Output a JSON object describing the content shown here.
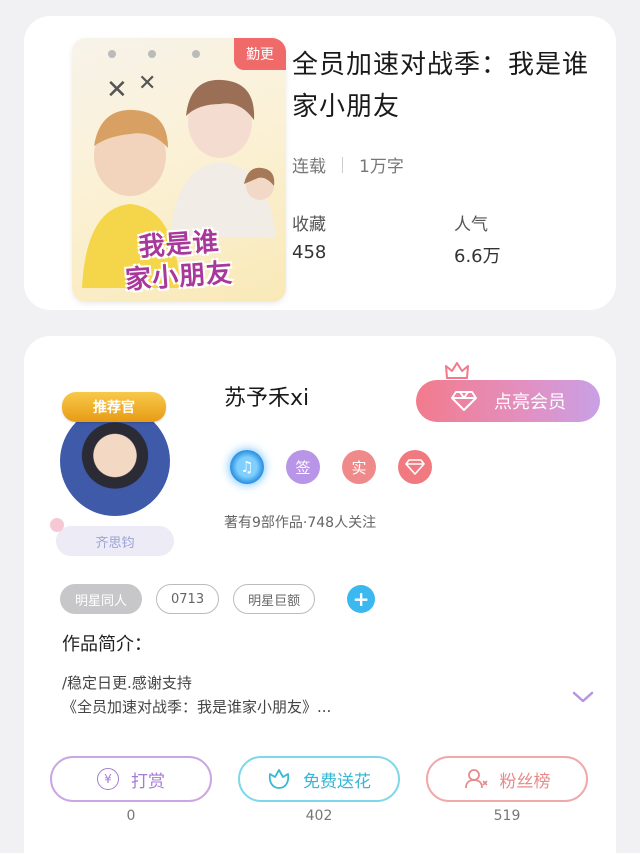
{
  "book": {
    "cover_tag": "勤更",
    "cover_title_1": "我是谁",
    "cover_title_2": "家小朋友",
    "title": "全员加速对战季：我是谁家小朋友",
    "status": "连载",
    "word_count": "1万字",
    "favorites_label": "收藏",
    "favorites_value": "458",
    "popularity_label": "人气",
    "popularity_value": "6.6万"
  },
  "author": {
    "badge_ribbon": "推荐官",
    "name_tag": "齐思钧",
    "name": "苏予禾xi",
    "vip_label": "点亮会员",
    "badges": [
      "♫",
      "签",
      "实",
      "diamond-icon"
    ],
    "works_line": "著有9部作品·748人关注",
    "tags": [
      "明星同人",
      "0713",
      "明星巨额"
    ],
    "intro_title": "作品简介：",
    "intro_line_1": "/稳定日更.感谢支持",
    "intro_line_2": "《全员加速对战季：我是谁家小朋友》..."
  },
  "actions": {
    "reward_label": "打赏",
    "reward_count": "0",
    "flower_label": "免费送花",
    "flower_count": "402",
    "fans_label": "粉丝榜",
    "fans_count": "519"
  },
  "colors": {
    "accent_pink": "#f27b8c",
    "accent_purple": "#c9a0e6",
    "accent_blue": "#3cb8f0"
  }
}
